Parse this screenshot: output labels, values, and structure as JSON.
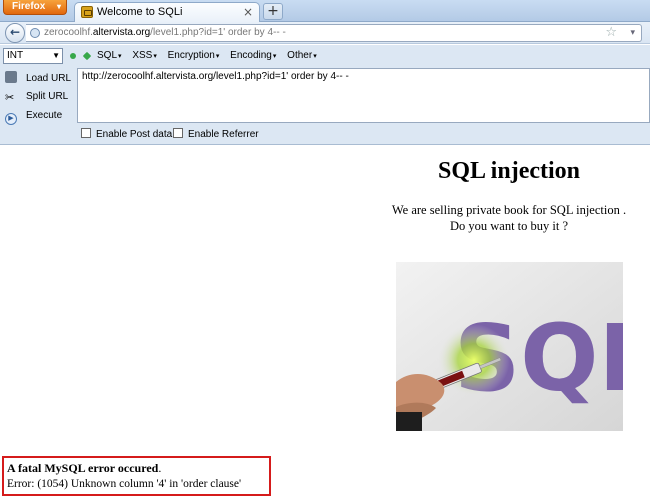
{
  "browser": {
    "app_button": "Firefox",
    "tab_title": "Welcome to SQLi",
    "new_tab_label": "+",
    "tab_close": "×"
  },
  "navbar": {
    "url_prefix": "zerocoolhf.",
    "url_domain": "altervista.org",
    "url_path": "/level1.php?id=1' order by 4-- -"
  },
  "hackbar": {
    "type_select": "INT",
    "menus": [
      "SQL",
      "XSS",
      "Encryption",
      "Encoding",
      "Other"
    ],
    "side_items": [
      "Load URL",
      "Split URL",
      "Execute"
    ],
    "url_text": "http://zerocoolhf.altervista.org/level1.php?id=1' order by 4-- -",
    "checkboxes": [
      "Enable Post data",
      "Enable Referrer"
    ]
  },
  "page": {
    "title": "SQL injection",
    "line1": "We are selling private book for SQL injection .",
    "line2": "Do you want to buy it ?",
    "image_text": "SQL"
  },
  "error": {
    "fatal_bold": "A fatal MySQL error occured",
    "fatal_tail": ".",
    "detail": "Error: (1054) Unknown column '4' in 'order clause'"
  },
  "colors": {
    "firefox_orange": "#e2680d",
    "error_border": "#d51b1b",
    "sql_purple": "#7b63a8"
  }
}
